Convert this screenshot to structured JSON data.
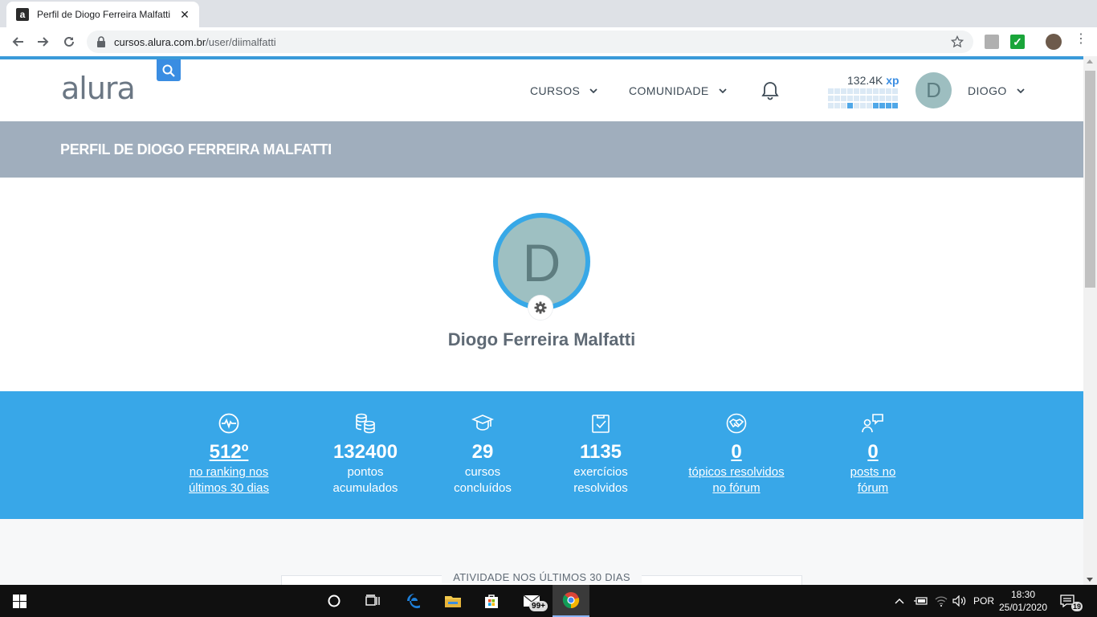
{
  "browser": {
    "tab_title": "Perfil de Diogo Ferreira Malfatti |",
    "tab_favicon": "a",
    "tab_close": "✕",
    "url_host": "cursos.alura.com.br",
    "url_path": "/user/diimalfatti"
  },
  "header": {
    "logo": "alura",
    "nav_cursos": "CURSOS",
    "nav_comunidade": "COMUNIDADE",
    "xp_value": "132.4K",
    "xp_unit": "xp",
    "xp_activity_levels": [
      0,
      0,
      0,
      0,
      0,
      0,
      0,
      0,
      0,
      0,
      0,
      0,
      0,
      0,
      0,
      0,
      0,
      0,
      0,
      0,
      0,
      0,
      0,
      0,
      0,
      1,
      0,
      0,
      0,
      1,
      1,
      1,
      1
    ],
    "user_initial": "D",
    "user_name": "DIOGO"
  },
  "banner": {
    "title": "PERFIL DE DIOGO FERREIRA MALFATTI"
  },
  "profile": {
    "initial": "D",
    "name": "Diogo Ferreira Malfatti"
  },
  "stats": [
    {
      "icon": "pulse-icon",
      "value": "512º",
      "label_1": "no ranking nos",
      "label_2": "últimos 30 dias",
      "link": true
    },
    {
      "icon": "coins-icon",
      "value": "132400",
      "label_1": "pontos",
      "label_2": "acumulados",
      "link": false
    },
    {
      "icon": "graduation-cap-icon",
      "value": "29",
      "label_1": "cursos",
      "label_2": "concluídos",
      "link": false
    },
    {
      "icon": "clipboard-check-icon",
      "value": "1135",
      "label_1": "exercícios",
      "label_2": "resolvidos",
      "link": false
    },
    {
      "icon": "handshake-icon",
      "value": "0",
      "label_1": "tópicos resolvidos",
      "label_2": "no fórum",
      "link": true
    },
    {
      "icon": "forum-post-icon",
      "value": "0",
      "label_1": "posts no",
      "label_2": "fórum",
      "link": true
    }
  ],
  "activity": {
    "title": "ATIVIDADE NOS ÚLTIMOS 30 DIAS"
  },
  "taskbar": {
    "mail_badge": "99+",
    "language": "POR",
    "time": "18:30",
    "date": "25/01/2020",
    "notification_count": "19"
  },
  "colors": {
    "accent_blue": "#38a7e8",
    "banner_gray": "#a0aebd",
    "avatar_teal": "#9ec0c2"
  }
}
